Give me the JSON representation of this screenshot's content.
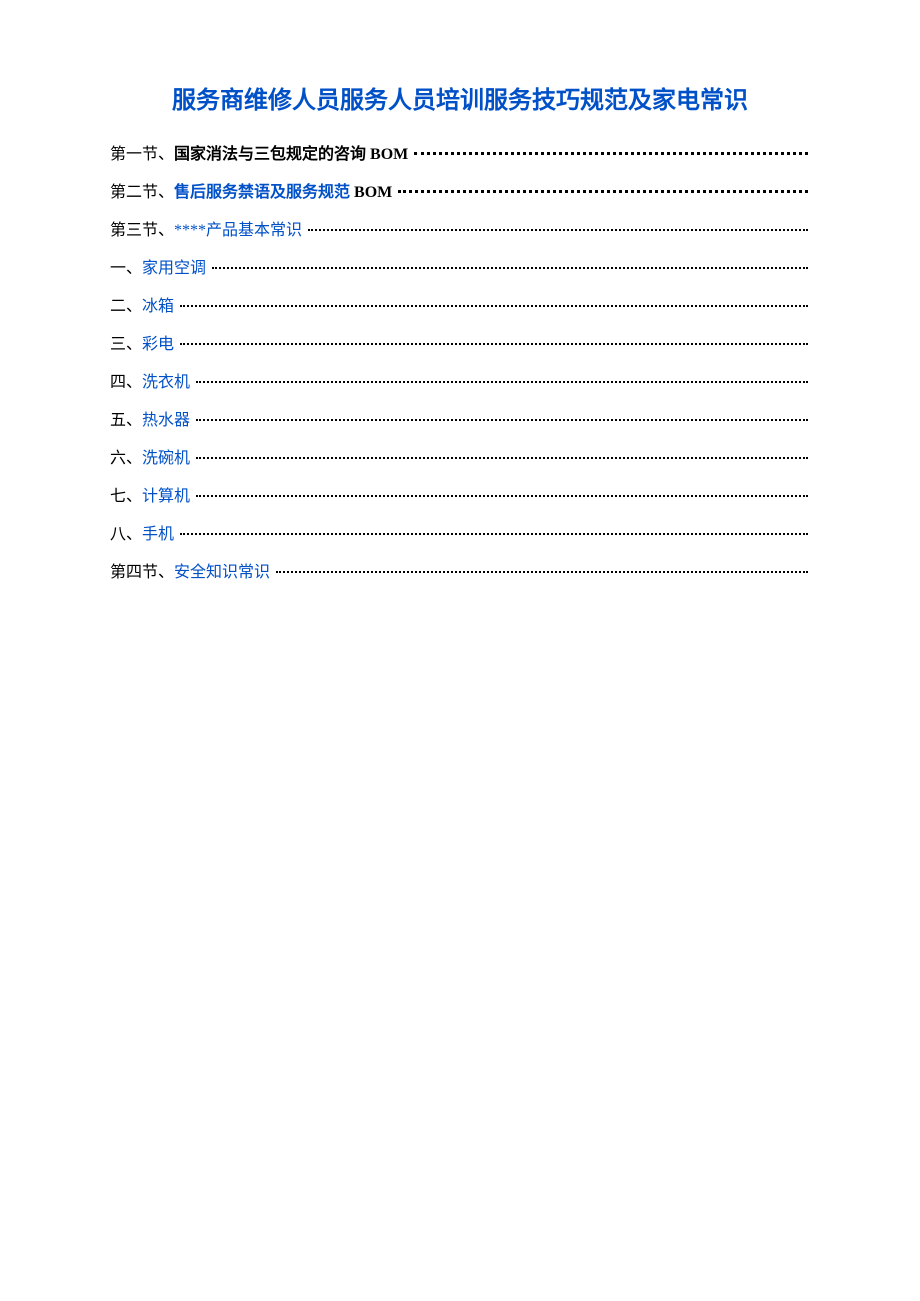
{
  "title": "服务商维修人员服务人员培训服务技巧规范及家电常识",
  "toc": {
    "entries": [
      {
        "prefix": "第一节、",
        "text": "国家消法与三包规定的咨询",
        "suffix": " BOM ",
        "bold": true,
        "link": false
      },
      {
        "prefix": "第二节、",
        "text": "售后服务禁语及服务规范",
        "suffix": " BOM ",
        "bold": true,
        "link": true
      },
      {
        "prefix": "第三节、",
        "text": "****产品基本常识",
        "suffix": "",
        "bold": false,
        "link": true
      },
      {
        "prefix": "一、",
        "text": "家用空调",
        "suffix": "",
        "bold": false,
        "link": true
      },
      {
        "prefix": "二、",
        "text": "冰箱",
        "suffix": "",
        "bold": false,
        "link": true
      },
      {
        "prefix": "三、",
        "text": "彩电",
        "suffix": "",
        "bold": false,
        "link": true
      },
      {
        "prefix": "四、",
        "text": "洗衣机",
        "suffix": "",
        "bold": false,
        "link": true
      },
      {
        "prefix": "五、",
        "text": "热水器",
        "suffix": "",
        "bold": false,
        "link": true
      },
      {
        "prefix": "六、",
        "text": "洗碗机",
        "suffix": "",
        "bold": false,
        "link": true
      },
      {
        "prefix": "七、",
        "text": "计算机",
        "suffix": "",
        "bold": false,
        "link": true
      },
      {
        "prefix": "八、",
        "text": "手机",
        "suffix": "",
        "bold": false,
        "link": true
      },
      {
        "prefix": "第四节、",
        "text": "安全知识常识",
        "suffix": "",
        "bold": false,
        "link": true
      }
    ]
  }
}
